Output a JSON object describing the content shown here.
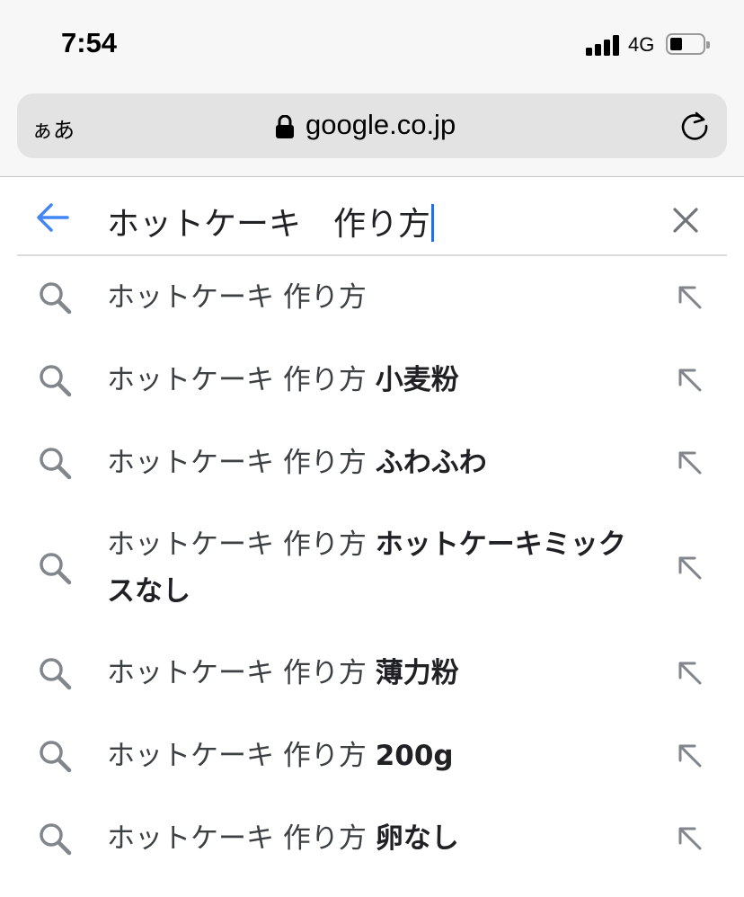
{
  "status_bar": {
    "time": "7:54",
    "network": "4G"
  },
  "browser": {
    "text_size_button": "ぁあ",
    "domain": "google.co.jp"
  },
  "search": {
    "query": "ホットケーキ　作り方"
  },
  "suggestions": [
    {
      "base": "ホットケーキ 作り方",
      "bold": ""
    },
    {
      "base": "ホットケーキ 作り方",
      "bold": "小麦粉"
    },
    {
      "base": "ホットケーキ 作り方",
      "bold": "ふわふわ"
    },
    {
      "base": "ホットケーキ 作り方",
      "bold": "ホットケーキミックスなし"
    },
    {
      "base": "ホットケーキ 作り方",
      "bold": "薄力粉"
    },
    {
      "base": "ホットケーキ 作り方",
      "bold": "200g"
    },
    {
      "base": "ホットケーキ 作り方",
      "bold": "卵なし"
    }
  ],
  "colors": {
    "accent": "#1a73e8",
    "icon_gray": "#80868b"
  },
  "icons": {
    "search": "search-icon",
    "fill": "arrow-up-left-icon",
    "back": "back-arrow-icon",
    "clear": "close-icon",
    "lock": "lock-icon",
    "reload": "reload-icon"
  }
}
